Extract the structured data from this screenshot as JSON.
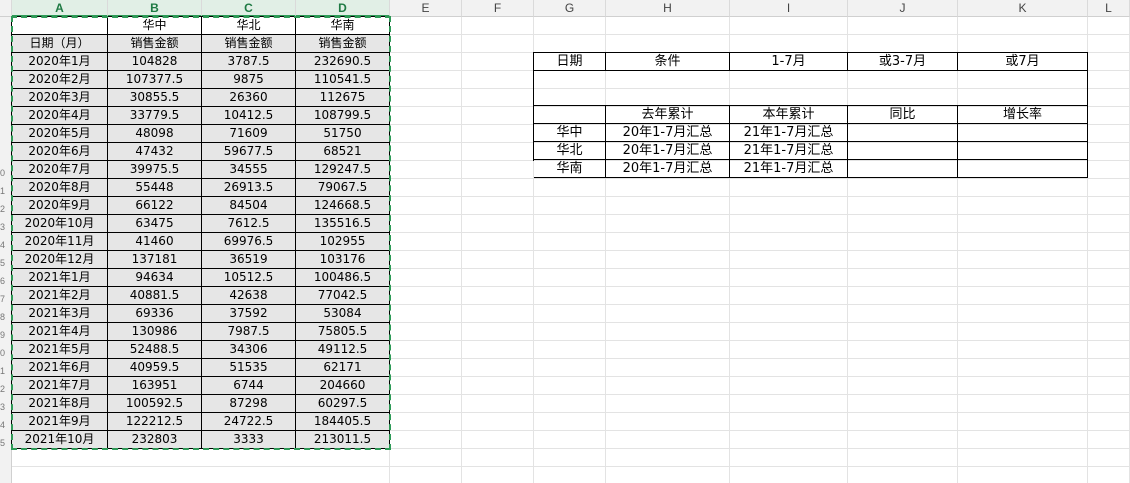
{
  "columns": [
    "A",
    "B",
    "C",
    "D",
    "E",
    "F",
    "G",
    "H",
    "I",
    "J",
    "K",
    "L"
  ],
  "selected_columns": [
    "A",
    "B",
    "C",
    "D"
  ],
  "row_number_marks": [
    "0",
    "1",
    "2",
    "3",
    "4",
    "5",
    "6",
    "7",
    "8",
    "9",
    "0",
    "1",
    "2",
    "3",
    "4",
    "5"
  ],
  "left_table": {
    "header_row1": [
      "",
      "华中",
      "华北",
      "华南"
    ],
    "header_row2": [
      "日期（月）",
      "销售金额",
      "销售金额",
      "销售金额"
    ],
    "rows": [
      [
        "2020年1月",
        "104828",
        "3787.5",
        "232690.5"
      ],
      [
        "2020年2月",
        "107377.5",
        "9875",
        "110541.5"
      ],
      [
        "2020年3月",
        "30855.5",
        "26360",
        "112675"
      ],
      [
        "2020年4月",
        "33779.5",
        "10412.5",
        "108799.5"
      ],
      [
        "2020年5月",
        "48098",
        "71609",
        "51750"
      ],
      [
        "2020年6月",
        "47432",
        "59677.5",
        "68521"
      ],
      [
        "2020年7月",
        "39975.5",
        "34555",
        "129247.5"
      ],
      [
        "2020年8月",
        "55448",
        "26913.5",
        "79067.5"
      ],
      [
        "2020年9月",
        "66122",
        "84504",
        "124668.5"
      ],
      [
        "2020年10月",
        "63475",
        "7612.5",
        "135516.5"
      ],
      [
        "2020年11月",
        "41460",
        "69976.5",
        "102955"
      ],
      [
        "2020年12月",
        "137181",
        "36519",
        "103176"
      ],
      [
        "2021年1月",
        "94634",
        "10512.5",
        "100486.5"
      ],
      [
        "2021年2月",
        "40881.5",
        "42638",
        "77042.5"
      ],
      [
        "2021年3月",
        "69336",
        "37592",
        "53084"
      ],
      [
        "2021年4月",
        "130986",
        "7987.5",
        "75805.5"
      ],
      [
        "2021年5月",
        "52488.5",
        "34306",
        "49112.5"
      ],
      [
        "2021年6月",
        "40959.5",
        "51535",
        "62171"
      ],
      [
        "2021年7月",
        "163951",
        "6744",
        "204660"
      ],
      [
        "2021年8月",
        "100592.5",
        "87298",
        "60297.5"
      ],
      [
        "2021年9月",
        "122212.5",
        "24722.5",
        "184405.5"
      ],
      [
        "2021年10月",
        "232803",
        "3333",
        "213011.5"
      ]
    ]
  },
  "right_table": {
    "row1": [
      "日期",
      "条件",
      "1-7月",
      "或3-7月",
      "或7月"
    ],
    "row3": [
      "",
      "去年累计",
      "本年累计",
      "同比",
      "增长率"
    ],
    "rows": [
      [
        "华中",
        "20年1-7月汇总",
        "21年1-7月汇总",
        "",
        ""
      ],
      [
        "华北",
        "20年1-7月汇总",
        "21年1-7月汇总",
        "",
        ""
      ],
      [
        "华南",
        "20年1-7月汇总",
        "21年1-7月汇总",
        "",
        ""
      ]
    ]
  },
  "colors": {
    "selection_border": "#2e9a57",
    "selected_header_bg": "#e1efe6",
    "data_cell_bg": "#e6e6e6"
  }
}
